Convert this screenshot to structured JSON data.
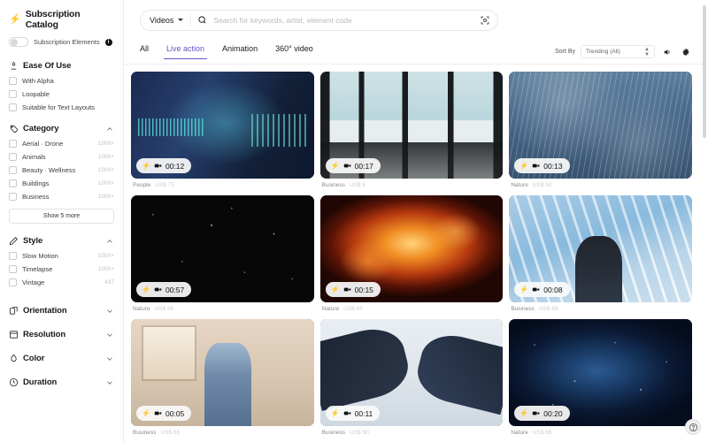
{
  "sidebar": {
    "brand": {
      "title": "Subscription Catalog",
      "icon": "bolt-icon"
    },
    "subscription_toggle": {
      "label": "Subscription Elements",
      "state": "off",
      "info_icon": "info-icon"
    },
    "groups": [
      {
        "title": "Ease Of Use",
        "icon": "ease-of-use-icon",
        "expanded": true,
        "options": [
          {
            "label": "With Alpha",
            "count": ""
          },
          {
            "label": "Loopable",
            "count": ""
          },
          {
            "label": "Suitable for Text Layouts",
            "count": ""
          }
        ]
      },
      {
        "title": "Category",
        "icon": "tag-icon",
        "expanded": true,
        "options": [
          {
            "label": "Aerial · Drone",
            "count": "1000+"
          },
          {
            "label": "Animals",
            "count": "1000+"
          },
          {
            "label": "Beauty · Wellness",
            "count": "1000+"
          },
          {
            "label": "Buildings",
            "count": "1000+"
          },
          {
            "label": "Business",
            "count": "1000+"
          }
        ],
        "show_more": "Show 5 more"
      },
      {
        "title": "Style",
        "icon": "pencil-icon",
        "expanded": true,
        "options": [
          {
            "label": "Slow Motion",
            "count": "1000+"
          },
          {
            "label": "Timelapse",
            "count": "1000+"
          },
          {
            "label": "Vintage",
            "count": "437"
          }
        ]
      }
    ],
    "collapsed_groups": [
      {
        "title": "Orientation",
        "icon": "orientation-icon"
      },
      {
        "title": "Resolution",
        "icon": "resolution-icon"
      },
      {
        "title": "Color",
        "icon": "color-drop-icon"
      },
      {
        "title": "Duration",
        "icon": "clock-icon"
      }
    ]
  },
  "search": {
    "type_label": "Videos",
    "placeholder": "Search for keywords, artist, element code",
    "value": "",
    "search_icon": "search-icon",
    "scan_icon": "scan-icon"
  },
  "tabs": [
    {
      "label": "All",
      "active": false
    },
    {
      "label": "Live action",
      "active": true
    },
    {
      "label": "Animation",
      "active": false
    },
    {
      "label": "360° video",
      "active": false
    }
  ],
  "toolbar": {
    "sort_by_label": "Sort By",
    "sort_value": "Trending (All)",
    "sound_icon": "sound-on-icon",
    "settings_icon": "gear-icon"
  },
  "results": [
    {
      "duration": "00:12",
      "category": "People",
      "price": "US$ 75",
      "art": "art-data"
    },
    {
      "duration": "00:17",
      "category": "Business",
      "price": "US$ 6",
      "art": "art-office"
    },
    {
      "duration": "00:13",
      "category": "Nature",
      "price": "US$ 50",
      "art": "art-rain"
    },
    {
      "duration": "00:57",
      "category": "Nature",
      "price": "US$ 56",
      "art": "art-space"
    },
    {
      "duration": "00:15",
      "category": "Nature",
      "price": "US$ 65",
      "art": "art-fire"
    },
    {
      "duration": "00:08",
      "category": "Business",
      "price": "US$ 69",
      "art": "art-glass"
    },
    {
      "duration": "00:05",
      "category": "Business",
      "price": "US$ 65",
      "art": "art-room"
    },
    {
      "duration": "00:11",
      "category": "Business",
      "price": "US$ 90",
      "art": "art-hands"
    },
    {
      "duration": "00:20",
      "category": "Nature",
      "price": "US$ 65",
      "art": "art-nebula"
    }
  ],
  "help": {
    "icon": "help-circle-icon"
  },
  "colors": {
    "accent": "#6255c4",
    "brand": "#1f3b8f",
    "badge_bolt": "#2f6fd0"
  }
}
